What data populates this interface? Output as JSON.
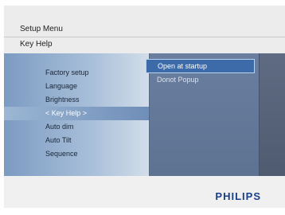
{
  "header": {
    "title": "Setup Menu",
    "subtitle": "Key Help"
  },
  "menu": {
    "items": [
      {
        "label": "Factory setup",
        "selected": false
      },
      {
        "label": "Language",
        "selected": false
      },
      {
        "label": "Brightness",
        "selected": false
      },
      {
        "label": "< Key Help >",
        "selected": true
      },
      {
        "label": "Auto dim",
        "selected": false
      },
      {
        "label": "Auto Tilt",
        "selected": false
      },
      {
        "label": "Sequence",
        "selected": false
      }
    ]
  },
  "options": {
    "items": [
      {
        "label": "Open at startup",
        "selected": true
      },
      {
        "label": "Donot Popup",
        "selected": false
      }
    ]
  },
  "footer": {
    "brand": "PHILIPS"
  },
  "colors": {
    "brand": "#1a3f8f",
    "selection": "#3d6aa8"
  }
}
